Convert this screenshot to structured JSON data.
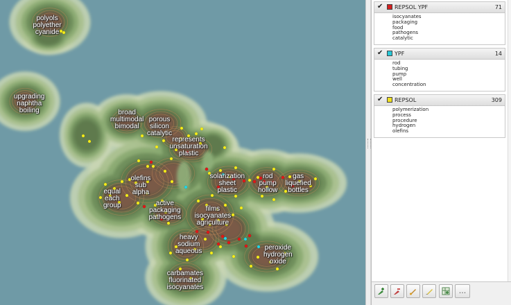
{
  "map": {
    "labels": [
      {
        "id": "lbl-polyols",
        "lines": [
          "polyols",
          "polyether",
          "cyanide"
        ]
      },
      {
        "id": "lbl-upgrading",
        "lines": [
          "upgrading",
          "naphtha",
          "boiling"
        ]
      },
      {
        "id": "lbl-broad",
        "lines": [
          "broad",
          "multimodal",
          "bimodal"
        ]
      },
      {
        "id": "lbl-porous",
        "lines": [
          "porous",
          "silicon",
          "catalytic"
        ]
      },
      {
        "id": "lbl-represents",
        "lines": [
          "represents",
          "unsaturation",
          "plastic"
        ]
      },
      {
        "id": "lbl-olefins",
        "lines": [
          "olefins",
          "sub",
          "alpha"
        ]
      },
      {
        "id": "lbl-equal",
        "lines": [
          "equal",
          "each",
          "group"
        ]
      },
      {
        "id": "lbl-active",
        "lines": [
          "active",
          "packaging",
          "pathogens"
        ]
      },
      {
        "id": "lbl-solarization",
        "lines": [
          "solarization",
          "sheet",
          "plastic"
        ]
      },
      {
        "id": "lbl-rod",
        "lines": [
          "rod",
          "pump",
          "hollow"
        ]
      },
      {
        "id": "lbl-gas",
        "lines": [
          "gas",
          "liquefied",
          "bottles"
        ]
      },
      {
        "id": "lbl-films",
        "lines": [
          "films",
          "isocyanates",
          "agriculture"
        ]
      },
      {
        "id": "lbl-heavy",
        "lines": [
          "heavy",
          "sodium",
          "aqueous"
        ]
      },
      {
        "id": "lbl-peroxide",
        "lines": [
          "peroxide",
          "hydrogen",
          "oxide"
        ]
      },
      {
        "id": "lbl-carbamates",
        "lines": [
          "carbamates",
          "fluorinated",
          "isocyanates"
        ]
      }
    ]
  },
  "groups": [
    {
      "name": "REPSOL YPF",
      "count": "71",
      "color": "#d42020",
      "checked": "✔",
      "items": [
        "isocyanates",
        "packaging",
        "food",
        "pathogens",
        "catalytic"
      ]
    },
    {
      "name": "YPF",
      "count": "14",
      "color": "#28c8d8",
      "checked": "✔",
      "items": [
        "rod",
        "tubing",
        "pump",
        "well",
        "concentration"
      ]
    },
    {
      "name": "REPSOL",
      "count": "309",
      "color": "#f0e020",
      "checked": "✔",
      "items": [
        "polymerization",
        "process",
        "procedure",
        "hydrogen",
        "olefins"
      ]
    }
  ],
  "toolbar": {
    "buttons": [
      {
        "id": "tool-add-group-button",
        "icon": "add-group-icon"
      },
      {
        "id": "tool-remove-group-button",
        "icon": "remove-group-icon"
      },
      {
        "id": "tool-edit-group-button",
        "icon": "brush-icon"
      },
      {
        "id": "tool-highlight-button",
        "icon": "highlighter-icon"
      },
      {
        "id": "tool-settings-button",
        "icon": "grid-settings-icon"
      },
      {
        "id": "tool-more-button",
        "icon": "more-icon",
        "label": "..."
      }
    ]
  }
}
